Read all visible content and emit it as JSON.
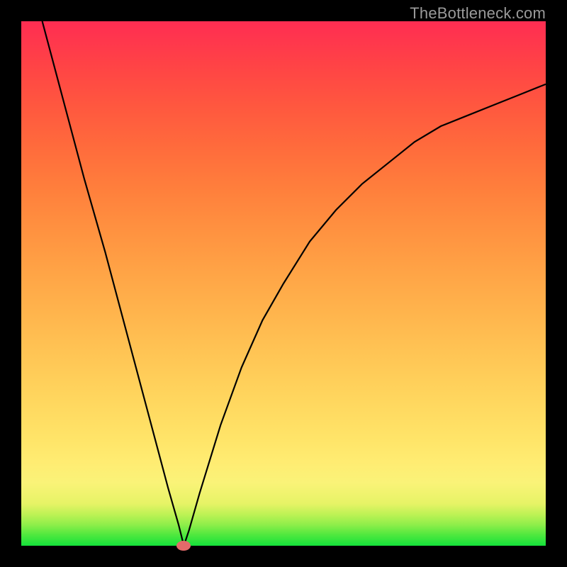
{
  "watermark": "TheBottleneck.com",
  "colors": {
    "background": "#000000",
    "gradient_top": "#ff2d52",
    "gradient_bottom": "#15e23b",
    "curve": "#000000",
    "marker": "#e46a6a"
  },
  "chart_data": {
    "type": "line",
    "title": "",
    "xlabel": "",
    "ylabel": "",
    "xlim": [
      0,
      100
    ],
    "ylim": [
      0,
      100
    ],
    "grid": false,
    "legend": false,
    "series": [
      {
        "name": "bottleneck-curve",
        "note": "V-shaped performance bottleneck curve; minimum near x≈31. Values estimated from pixel positions (no axis ticks present).",
        "x": [
          4,
          8,
          12,
          16,
          20,
          24,
          28,
          30,
          31,
          32,
          34,
          38,
          42,
          46,
          50,
          55,
          60,
          65,
          70,
          75,
          80,
          85,
          90,
          95,
          100
        ],
        "y": [
          100,
          85,
          70,
          56,
          41,
          26,
          11,
          4,
          0,
          3,
          10,
          23,
          34,
          43,
          50,
          58,
          64,
          69,
          73,
          77,
          80,
          82,
          84,
          86,
          88
        ]
      }
    ],
    "markers": [
      {
        "name": "optimal-point",
        "x": 31,
        "y": 0
      }
    ]
  }
}
